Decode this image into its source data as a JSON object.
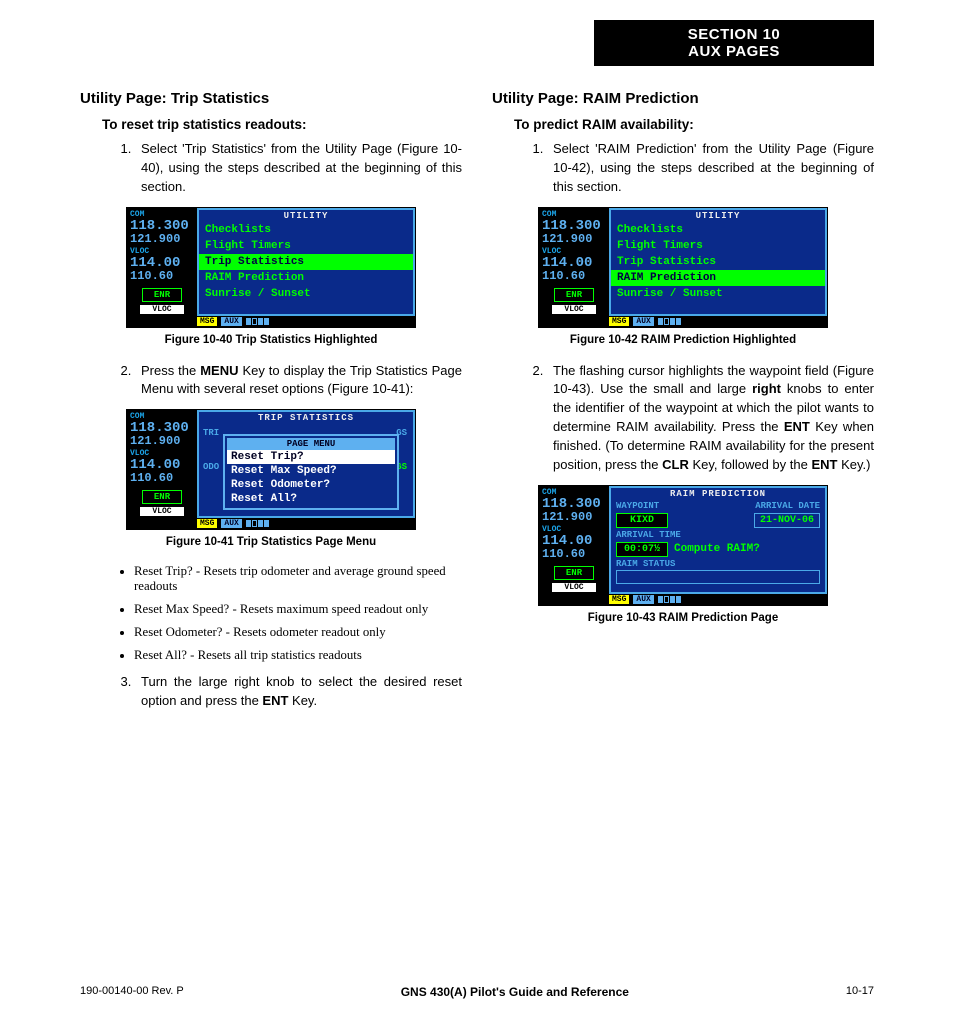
{
  "header": {
    "line1": "SECTION 10",
    "line2": "AUX PAGES"
  },
  "left": {
    "h2": "Utility Page: Trip Statistics",
    "h3": "To reset trip statistics readouts:",
    "step1": "Select 'Trip Statistics' from the Utility Page (Figure 10-40), using the steps described at the beginning of this section.",
    "cap40": "Figure 10-40  Trip Statistics Highlighted",
    "step2_a": "Press the ",
    "step2_menu": "MENU",
    "step2_b": " Key to display the Trip Statistics Page Menu with several reset options (Figure 10-41):",
    "cap41": "Figure 10-41  Trip Statistics Page Menu",
    "b1": "Reset Trip? - Resets trip odometer and average ground speed readouts",
    "b2": "Reset Max Speed? - Resets maximum speed readout only",
    "b3": "Reset Odometer? - Resets odometer readout only",
    "b4": "Reset All? - Resets all trip statistics readouts",
    "step3_a": "Turn the large right knob to select the desired reset option and press the ",
    "step3_ent": "ENT",
    "step3_b": " Key."
  },
  "right": {
    "h2": "Utility Page: RAIM Prediction",
    "h3": "To predict RAIM availability:",
    "step1": "Select 'RAIM Prediction' from the Utility Page (Figure 10-42), using the steps described at the beginning of this section.",
    "cap42": "Figure 10-42  RAIM Prediction Highlighted",
    "step2_a": "The flashing cursor highlights the waypoint field (Figure 10-43).  Use the small and large ",
    "step2_right": "right",
    "step2_b": " knobs to enter the identifier of the waypoint at which the pilot wants to determine RAIM availability.  Press the ",
    "step2_ent": "ENT",
    "step2_c": " Key when finished. (To determine RAIM availability for the present position, press the ",
    "step2_clr": "CLR",
    "step2_d": " Key, followed by the ",
    "step2_ent2": "ENT",
    "step2_e": " Key.)",
    "cap43": "Figure 10-43  RAIM Prediction Page"
  },
  "gps_common": {
    "com_lbl": "COM",
    "com1": "118.300",
    "com2": "121.900",
    "vloc_lbl": "VLOC",
    "vloc1": "114.00",
    "vloc2": "110.60",
    "enr": "ENR",
    "vloc_bot": "VLOC",
    "msg": "MSG",
    "aux": "AUX"
  },
  "fig40": {
    "title": "UTILITY",
    "items": [
      "Checklists",
      "Flight Timers",
      "Trip Statistics",
      "RAIM Prediction",
      "Sunrise / Sunset"
    ],
    "highlight_index": 2
  },
  "fig41": {
    "title": "TRIP STATISTICS",
    "bg_labels": {
      "trip": "TRI",
      "odo": "ODO",
      "gs": "GS"
    },
    "popup_title": "PAGE MENU",
    "popup_items": [
      "Reset Trip?",
      "Reset Max Speed?",
      "Reset Odometer?",
      "Reset All?"
    ],
    "highlight_index": 0
  },
  "fig42": {
    "title": "UTILITY",
    "items": [
      "Checklists",
      "Flight Timers",
      "Trip Statistics",
      "RAIM Prediction",
      "Sunrise / Sunset"
    ],
    "highlight_index": 3
  },
  "fig43": {
    "title": "RAIM PREDICTION",
    "waypoint_lbl": "WAYPOINT",
    "waypoint": "KIXD",
    "arrdate_lbl": "ARRIVAL DATE",
    "arrdate": "21-NOV-06",
    "arrtime_lbl": "ARRIVAL TIME",
    "arrtime": "00:07½",
    "compute": "Compute RAIM?",
    "status_lbl": "RAIM STATUS"
  },
  "footer": {
    "left": "190-00140-00  Rev. P",
    "center": "GNS 430(A) Pilot's Guide and Reference",
    "right": "10-17"
  }
}
